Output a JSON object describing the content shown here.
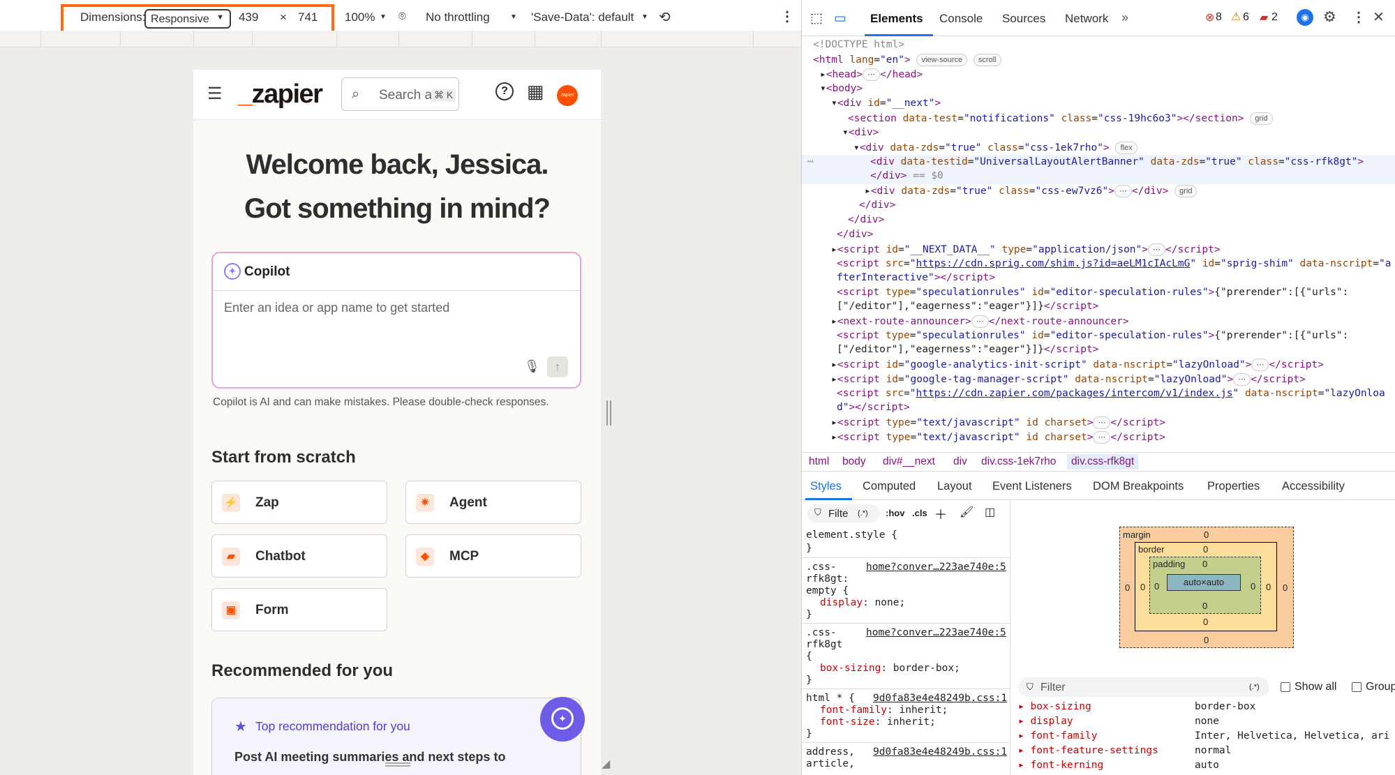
{
  "device_toolbar": {
    "dimensions_label": "Dimensions:",
    "mode": "Responsive",
    "width": "439",
    "times": "×",
    "height": "741",
    "zoom": "100%",
    "throttling": "No throttling",
    "save_data": "'Save-Data': default"
  },
  "zapier": {
    "logo": "_zapier",
    "search_placeholder": "Search ass",
    "search_shortcut": "⌘ K",
    "avatar_text": "zapier",
    "welcome_line1": "Welcome back, Jessica.",
    "welcome_line2": "Got something in mind?",
    "copilot_title": "Copilot",
    "copilot_placeholder": "Enter an idea or app name to get started",
    "copilot_disclaimer": "Copilot is AI and can make mistakes. Please double-check responses.",
    "scratch_heading": "Start from scratch",
    "cards": [
      "Zap",
      "Agent",
      "Chatbot",
      "MCP",
      "Form"
    ],
    "recommended_heading": "Recommended for you",
    "top_recommendation": "Top recommendation for you",
    "rec_text": "Post AI meeting summaries and next steps to"
  },
  "devtools": {
    "tabs": [
      "Elements",
      "Console",
      "Sources",
      "Network"
    ],
    "errors": "8",
    "warnings": "6",
    "issues": "2",
    "breadcrumbs": [
      "html",
      "body",
      "div#__next",
      "div",
      "div.css-1ek7rho",
      "div.css-rfk8gt"
    ],
    "style_tabs": [
      "Styles",
      "Computed",
      "Layout",
      "Event Listeners",
      "DOM Breakpoints",
      "Properties",
      "Accessibility"
    ],
    "filter_placeholder": "Filte",
    "filter_regex": "(.*)",
    "hov": ":hov",
    "cls": ".cls",
    "computed_filter": "Filter",
    "show_all": "Show all",
    "group": "Group",
    "boxmodel": {
      "margin_label": "margin",
      "border_label": "border",
      "padding_label": "padding",
      "content": "auto×auto",
      "zero": "0"
    },
    "computed_props": [
      {
        "name": "box-sizing",
        "value": "border-box"
      },
      {
        "name": "display",
        "value": "none"
      },
      {
        "name": "font-family",
        "value": "Inter, Helvetica, Helvetica, ari"
      },
      {
        "name": "font-feature-settings",
        "value": "normal"
      },
      {
        "name": "font-kerning",
        "value": "auto"
      }
    ]
  }
}
